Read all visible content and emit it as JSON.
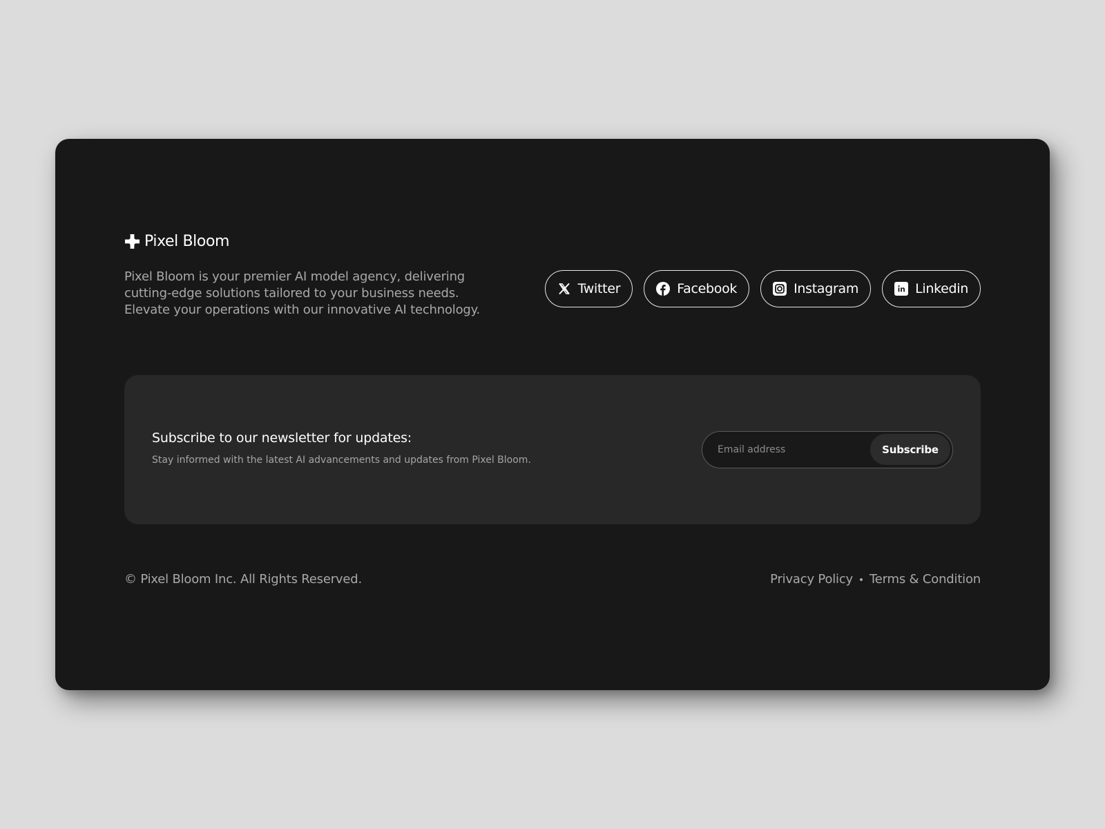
{
  "brand": {
    "name": "Pixel Bloom",
    "description": "Pixel Bloom is your premier AI model agency, delivering cutting-edge solutions tailored to your business needs. Elevate your operations with our innovative AI technology."
  },
  "social": [
    {
      "label": "Twitter",
      "icon": "x-icon"
    },
    {
      "label": "Facebook",
      "icon": "facebook-icon"
    },
    {
      "label": "Instagram",
      "icon": "instagram-icon"
    },
    {
      "label": "Linkedin",
      "icon": "linkedin-icon"
    }
  ],
  "newsletter": {
    "title": "Subscribe to our newsletter for updates:",
    "subtitle": "Stay informed with the latest AI advancements and updates from Pixel Bloom.",
    "email_placeholder": "Email address",
    "email_value": "",
    "button_label": "Subscribe"
  },
  "footer": {
    "copyright": "© Pixel Bloom Inc. All Rights Reserved.",
    "links": [
      "Privacy Policy",
      "Terms & Condition"
    ]
  },
  "colors": {
    "page_background": "#dcdcdc",
    "card_background": "#181818",
    "panel_background": "#282828",
    "text_primary": "#ffffff",
    "text_secondary": "#a9a9a9"
  }
}
